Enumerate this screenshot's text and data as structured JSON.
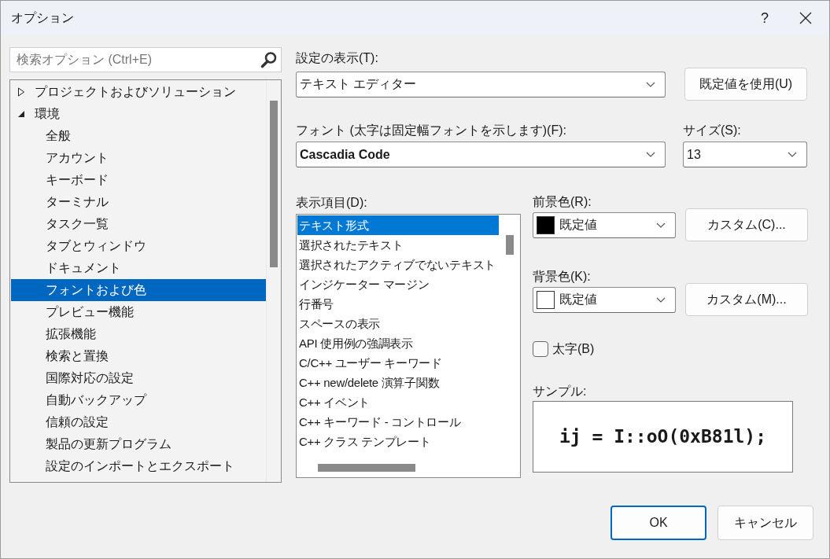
{
  "window": {
    "title": "オプション",
    "help": "?"
  },
  "search": {
    "placeholder": "検索オプション (Ctrl+E)"
  },
  "tree": [
    {
      "label": "プロジェクトおよびソリューション",
      "expanded": false,
      "selected": false
    },
    {
      "label": "環境",
      "expanded": true,
      "selected": false,
      "children": [
        {
          "label": "全般",
          "selected": false
        },
        {
          "label": "アカウント",
          "selected": false
        },
        {
          "label": "キーボード",
          "selected": false
        },
        {
          "label": "ターミナル",
          "selected": false
        },
        {
          "label": "タスク一覧",
          "selected": false
        },
        {
          "label": "タブとウィンドウ",
          "selected": false
        },
        {
          "label": "ドキュメント",
          "selected": false
        },
        {
          "label": "フォントおよび色",
          "selected": true
        },
        {
          "label": "プレビュー機能",
          "selected": false
        },
        {
          "label": "拡張機能",
          "selected": false
        },
        {
          "label": "検索と置換",
          "selected": false
        },
        {
          "label": "国際対応の設定",
          "selected": false
        },
        {
          "label": "自動バックアップ",
          "selected": false
        },
        {
          "label": "信頼の設定",
          "selected": false
        },
        {
          "label": "製品の更新プログラム",
          "selected": false
        },
        {
          "label": "設定のインポートとエクスポート",
          "selected": false
        }
      ]
    }
  ],
  "show_settings_for": {
    "label": "設定の表示(T):",
    "value": "テキスト エディター"
  },
  "use_defaults_button": "既定値を使用(U)",
  "font": {
    "label": "フォント (太字は固定幅フォントを示します)(F):",
    "value": "Cascadia Code"
  },
  "size": {
    "label": "サイズ(S):",
    "value": "13"
  },
  "display_items": {
    "label": "表示項目(D):",
    "items": [
      {
        "label": "テキスト形式",
        "selected": true
      },
      {
        "label": "選択されたテキスト",
        "selected": false
      },
      {
        "label": "選択されたアクティブでないテキスト",
        "selected": false
      },
      {
        "label": "インジケーター マージン",
        "selected": false
      },
      {
        "label": "行番号",
        "selected": false
      },
      {
        "label": "スペースの表示",
        "selected": false
      },
      {
        "label": "API 使用例の強調表示",
        "selected": false
      },
      {
        "label": "C/C++ ユーザー キーワード",
        "selected": false
      },
      {
        "label": "C++ new/delete 演算子関数",
        "selected": false
      },
      {
        "label": "C++ イベント",
        "selected": false
      },
      {
        "label": "C++ キーワード - コントロール",
        "selected": false
      },
      {
        "label": "C++ クラス テンプレート",
        "selected": false
      }
    ]
  },
  "foreground": {
    "label": "前景色(R):",
    "value": "既定値",
    "color": "#000000",
    "custom_button": "カスタム(C)..."
  },
  "background": {
    "label": "背景色(K):",
    "value": "既定値",
    "color": "#ffffff",
    "custom_button": "カスタム(M)..."
  },
  "bold": {
    "label": "太字(B)",
    "checked": false
  },
  "sample": {
    "label": "サンプル:",
    "text": "ij = I::oO(0xB81l);"
  },
  "buttons": [
    {
      "label": "OK",
      "kind": "default"
    },
    {
      "label": "キャンセル",
      "kind": "normal"
    }
  ]
}
